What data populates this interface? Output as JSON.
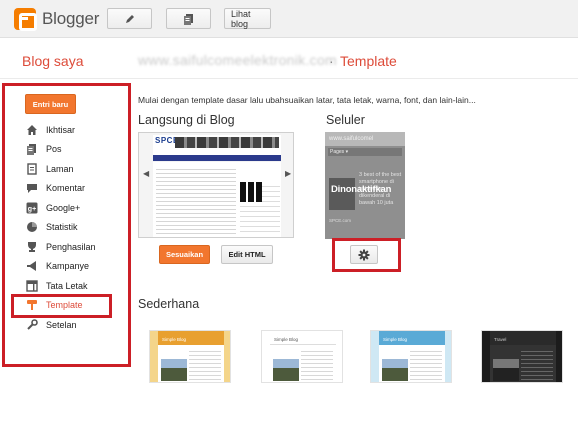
{
  "app": {
    "name": "Blogger"
  },
  "toolbar": {
    "view_blog_label": "Lihat blog"
  },
  "header": {
    "section_label": "Blog saya",
    "blog_url": "www.saifulcomeelektronik.com",
    "separator": "·",
    "page_title": "Template"
  },
  "sidebar": {
    "new_post_label": "Entri baru",
    "items": [
      {
        "label": "Ikhtisar",
        "icon": "home-icon"
      },
      {
        "label": "Pos",
        "icon": "posts-icon"
      },
      {
        "label": "Laman",
        "icon": "pages-icon"
      },
      {
        "label": "Komentar",
        "icon": "comment-icon"
      },
      {
        "label": "Google+",
        "icon": "google-plus-icon"
      },
      {
        "label": "Statistik",
        "icon": "stats-icon"
      },
      {
        "label": "Penghasilan",
        "icon": "earnings-icon"
      },
      {
        "label": "Kampanye",
        "icon": "campaign-icon"
      },
      {
        "label": "Tata Letak",
        "icon": "layout-icon"
      },
      {
        "label": "Template",
        "icon": "template-icon",
        "active": true
      },
      {
        "label": "Setelan",
        "icon": "wrench-icon"
      }
    ]
  },
  "main": {
    "intro": "Mulai dengan template dasar lalu ubahsuaikan latar, tata letak, warna, font, dan lain-lain...",
    "live": {
      "title": "Langsung di Blog",
      "preview_title": "SPCE",
      "customize_label": "Sesuaikan",
      "edit_html_label": "Edit HTML"
    },
    "mobile": {
      "title": "Seluler",
      "url": "www.saifulcomel",
      "pages_label": "Pages ▾",
      "post_text": "3 best of the best smartphone di indonesia dikenderal di bawah 10 juta",
      "overlay": "Dinonaktifkan",
      "footer_text": "SPCE.com"
    },
    "simple": {
      "title": "Sederhana",
      "templates": [
        {
          "label": "Simple Blog",
          "bar_color": "#e8a030",
          "bg_color": "#f4d58a"
        },
        {
          "label": "Simple Blog",
          "bar_color": "#ffffff",
          "bg_color": "#ffffff"
        },
        {
          "label": "Simple Blog",
          "bar_color": "#5aaad6",
          "bg_color": "#cfe8f4"
        },
        {
          "label": "Travel",
          "bar_color": "#2a2a2a",
          "bg_color": "#1c1c1c"
        }
      ]
    }
  },
  "colors": {
    "accent": "#dd4b39",
    "orange": "#f2762e",
    "highlight_frame": "#cc1f26"
  }
}
